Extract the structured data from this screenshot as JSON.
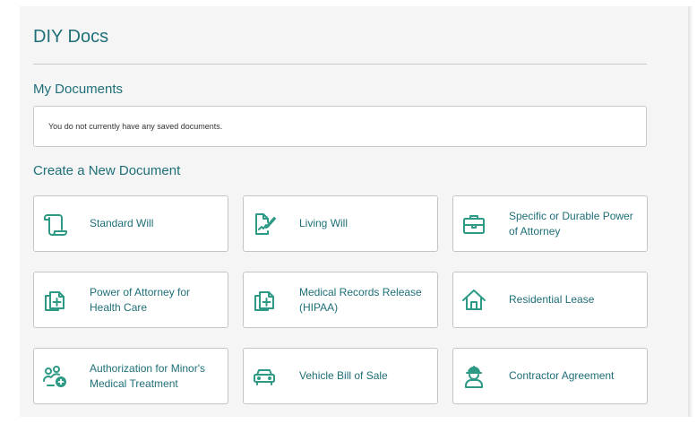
{
  "app": {
    "title": "DIY Docs"
  },
  "my_documents": {
    "heading": "My Documents",
    "empty_message": "You do not currently have any saved documents."
  },
  "create": {
    "heading": "Create a New Document",
    "items": [
      {
        "label": "Standard Will",
        "icon": "scroll-icon"
      },
      {
        "label": "Living Will",
        "icon": "document-signature-icon"
      },
      {
        "label": "Specific or Durable Power of Attorney",
        "icon": "briefcase-icon"
      },
      {
        "label": "Power of Attorney for Health Care",
        "icon": "medical-documents-icon"
      },
      {
        "label": "Medical Records Release (HIPAA)",
        "icon": "medical-documents-icon"
      },
      {
        "label": "Residential Lease",
        "icon": "house-icon"
      },
      {
        "label": "Authorization for Minor's Medical Treatment",
        "icon": "people-add-icon"
      },
      {
        "label": "Vehicle Bill of Sale",
        "icon": "car-icon"
      },
      {
        "label": "Contractor Agreement",
        "icon": "worker-icon"
      }
    ]
  },
  "colors": {
    "accent": "#1f6f78",
    "icon": "#2e9a86",
    "panel": "#f5f5f5",
    "border": "#c4c4c4"
  }
}
